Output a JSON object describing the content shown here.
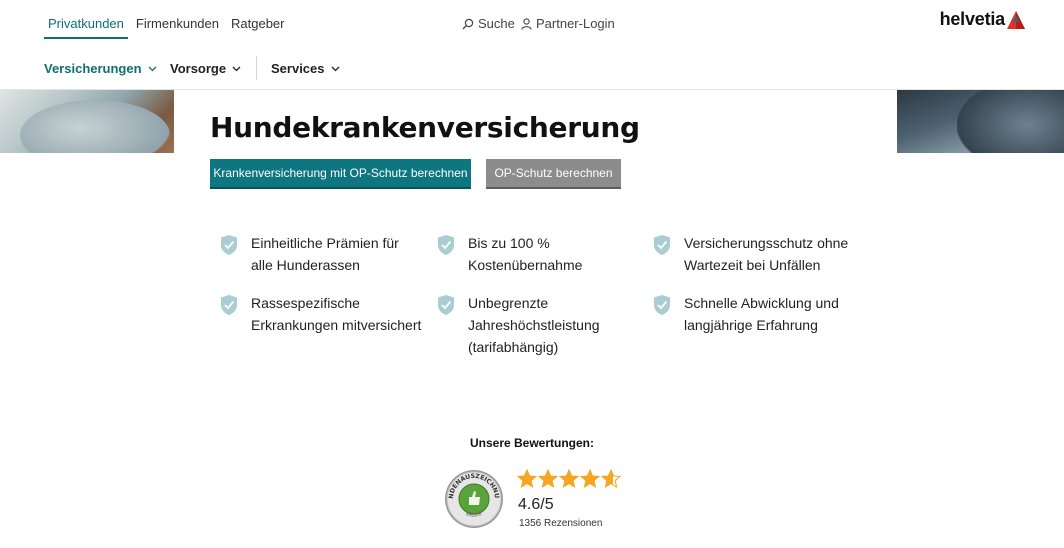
{
  "topbar": {
    "segments": [
      {
        "label": "Privatkunden",
        "active": true
      },
      {
        "label": "Firmenkunden",
        "active": false
      },
      {
        "label": "Ratgeber",
        "active": false
      }
    ],
    "search_label": "Suche",
    "login_label": "Partner-Login",
    "logo_text": "helvetia"
  },
  "mainnav": {
    "items": [
      {
        "label": "Versicherungen",
        "active": true
      },
      {
        "label": "Vorsorge",
        "active": false
      },
      {
        "label": "Services",
        "active": false
      }
    ]
  },
  "hero": {
    "title": "Hundekrankenversicherung",
    "primary_button": "Krankenversicherung mit OP-Schutz berechnen",
    "secondary_button": "OP-Schutz berechnen"
  },
  "features": [
    {
      "text": [
        "Einheitliche Prämien für",
        "alle Hunderassen"
      ]
    },
    {
      "text": [
        "Bis zu 100 %",
        "Kostenübernahme"
      ]
    },
    {
      "text": [
        "Versicherungsschutz ohne",
        "Wartezeit bei Unfällen"
      ]
    },
    {
      "text": [
        "Rassespezifische",
        "Erkrankungen mitversichert"
      ]
    },
    {
      "text": [
        "Unbegrenzte",
        "Jahreshöchstleistung",
        "(tarifabhängig)"
      ]
    },
    {
      "text": [
        "Schnelle Abwicklung und",
        "langjährige Erfahrung"
      ]
    }
  ],
  "ratings": {
    "title": "Unsere Bewertungen:",
    "badge_text": "KUNDENAUSZEICHNUNG",
    "badge_sub": "eKomi",
    "stars": 4.6,
    "stars_max": 5,
    "score": "4.6/5",
    "reviews": "1356 Rezensionen"
  },
  "colors": {
    "brand_teal": "#0e7680",
    "star": "#f5a623",
    "shield": "#a9cdd2",
    "logo_red": "#e0312b"
  }
}
